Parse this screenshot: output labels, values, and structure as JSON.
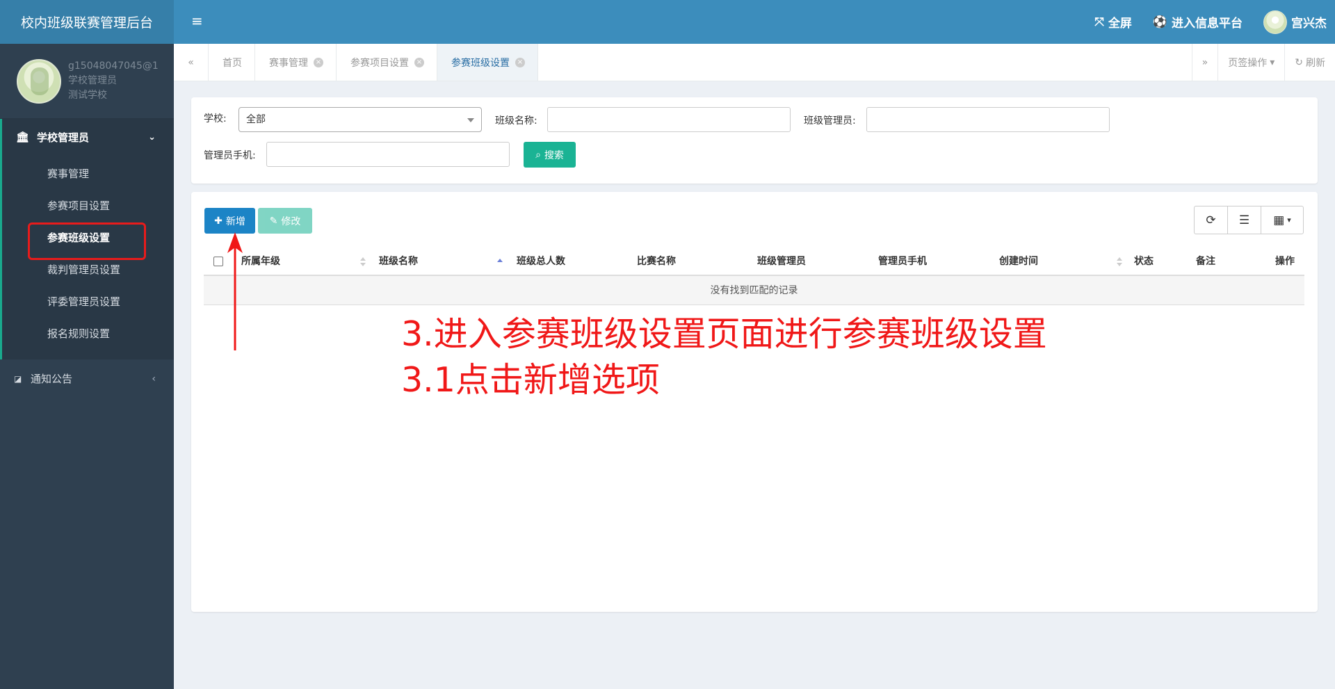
{
  "brand": "校内班级联赛管理后台",
  "user": {
    "account": "g15048047045@1",
    "role": "学校管理员",
    "school": "测试学校"
  },
  "menu": {
    "group1": {
      "label": "学校管理员",
      "icon": "bank-icon",
      "items": [
        "赛事管理",
        "参赛项目设置",
        "参赛班级设置",
        "裁判管理员设置",
        "评委管理员设置",
        "报名规则设置"
      ],
      "active": 2
    },
    "group2": {
      "label": "通知公告",
      "icon": "share-icon"
    }
  },
  "header": {
    "fullscreen": "全屏",
    "platform": "进入信息平台",
    "username": "宫兴杰"
  },
  "tabs": [
    {
      "label": "首页",
      "closable": false
    },
    {
      "label": "赛事管理",
      "closable": true
    },
    {
      "label": "参赛项目设置",
      "closable": true
    },
    {
      "label": "参赛班级设置",
      "closable": true,
      "active": true
    }
  ],
  "tab_actions": {
    "tab_ops": "页签操作",
    "refresh": "刷新"
  },
  "search": {
    "school_label": "学校:",
    "school_value": "全部",
    "class_name_label": "班级名称:",
    "class_admin_label": "班级管理员:",
    "admin_phone_label": "管理员手机:",
    "search_btn": "搜索"
  },
  "toolbar": {
    "add": "新增",
    "edit": "修改"
  },
  "table": {
    "columns": [
      "所属年级",
      "班级名称",
      "班级总人数",
      "比赛名称",
      "班级管理员",
      "管理员手机",
      "创建时间",
      "状态",
      "备注",
      "操作"
    ],
    "empty_text": "没有找到匹配的记录"
  },
  "annotation": {
    "line1": "3.进入参赛班级设置页面进行参赛班级设置",
    "line2": "3.1点击新增选项"
  },
  "colors": {
    "sidebar": "#2f4050",
    "header": "#3c8dbc",
    "brand": "#367fa9",
    "accent_green": "#1ab394",
    "primary_blue": "#1c84c6",
    "annotation_red": "#f01818"
  }
}
